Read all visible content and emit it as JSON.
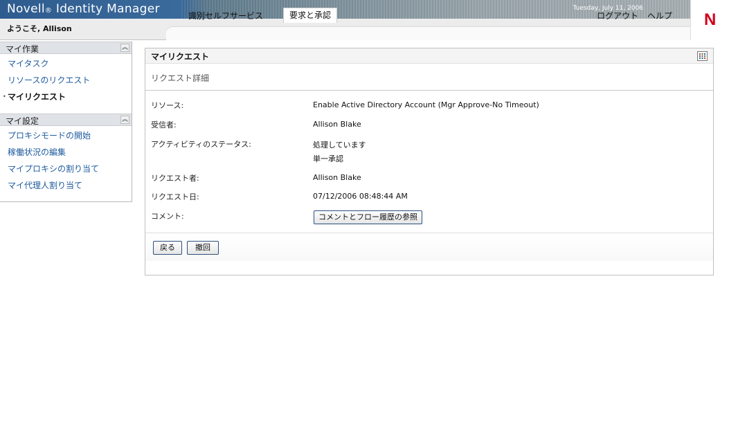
{
  "header": {
    "app_title_main": "Novell",
    "app_title_reg": "®",
    "app_title_rest": " Identity Manager",
    "date": "Tuesday, July 11, 2006",
    "logo_text": "N",
    "welcome": "ようこそ, Allison",
    "tabs": [
      {
        "label": "識別セルフサービス",
        "active": false
      },
      {
        "label": "要求と承認",
        "active": true
      }
    ],
    "logout": "ログアウト",
    "help": "ヘルプ"
  },
  "sidebar": {
    "sections": [
      {
        "title": "マイ作業",
        "collapse_icon": "double-chevron-up-icon",
        "items": [
          {
            "label": "マイタスク",
            "current": false
          },
          {
            "label": "リソースのリクエスト",
            "current": false
          },
          {
            "label": "マイリクエスト",
            "current": true
          }
        ]
      },
      {
        "title": "マイ設定",
        "collapse_icon": "double-chevron-up-icon",
        "items": [
          {
            "label": "プロキシモードの開始",
            "current": false
          },
          {
            "label": "稼働状況の編集",
            "current": false
          },
          {
            "label": "マイプロキシの割り当て",
            "current": false
          },
          {
            "label": "マイ代理人割り当て",
            "current": false
          }
        ]
      }
    ],
    "bullet": "•"
  },
  "panel": {
    "title": "マイリクエスト",
    "icon": "grid-view-icon",
    "subtitle": "リクエスト詳細",
    "rows": {
      "resource": {
        "label": "リソース:",
        "value": "Enable Active Directory Account (Mgr Approve-No Timeout)"
      },
      "recipient": {
        "label": "受信者:",
        "value": "Allison Blake"
      },
      "activity_status": {
        "label": "アクティビティのステータス:",
        "value_line1": "処理しています",
        "value_line2": "単一承認"
      },
      "requester": {
        "label": "リクエスト者:",
        "value": "Allison Blake"
      },
      "request_date": {
        "label": "リクエスト日:",
        "value": "07/12/2006 08:48:44 AM"
      },
      "comment": {
        "label": "コメント:",
        "button": "コメントとフロー履歴の参照"
      }
    },
    "buttons": {
      "back": "戻る",
      "withdraw": "撤回"
    }
  },
  "colors": {
    "banner": "#2f5c8e",
    "link": "#1d5a9e",
    "logo": "#d0021b"
  }
}
